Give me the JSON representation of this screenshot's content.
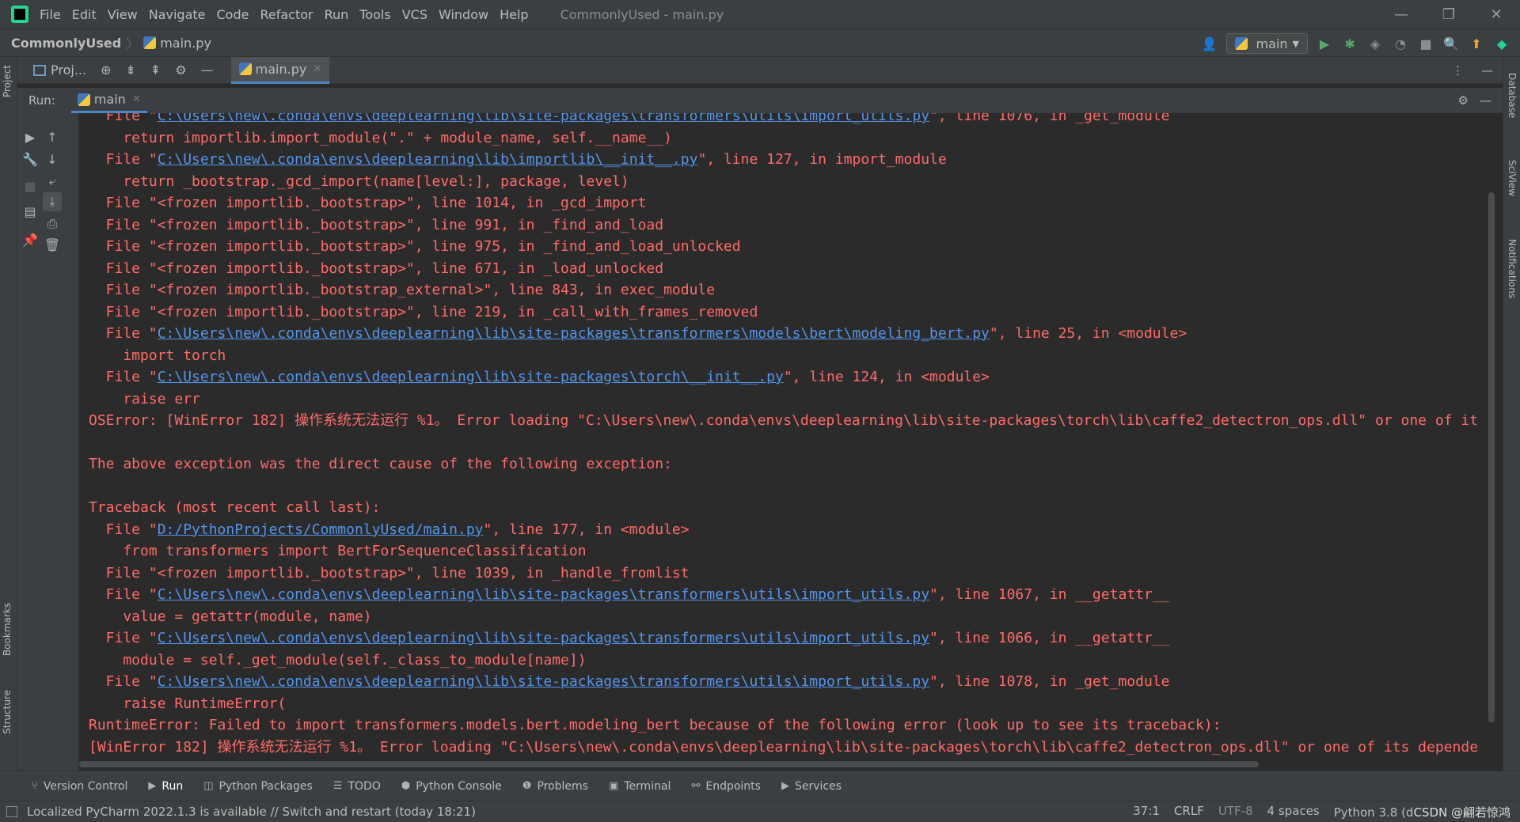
{
  "window": {
    "title": "CommonlyUsed - main.py",
    "menu": [
      "File",
      "Edit",
      "View",
      "Navigate",
      "Code",
      "Refactor",
      "Run",
      "Tools",
      "VCS",
      "Window",
      "Help"
    ],
    "controls": [
      "—",
      "❐",
      "✕"
    ]
  },
  "navbar": {
    "project": "CommonlyUsed",
    "file": "main.py",
    "run_config": "main"
  },
  "tabrow": {
    "project_tab": "Proj...",
    "editor_tab": "main.py"
  },
  "left_stripe": {
    "project": "Project",
    "bookmarks": "Bookmarks",
    "structure": "Structure"
  },
  "right_stripe": {
    "database": "Database",
    "sciview": "SciView",
    "notifications": "Notifications"
  },
  "run_panel": {
    "label": "Run:",
    "tab": "main"
  },
  "console": {
    "lines": [
      {
        "pre": "  File \"",
        "link": "C:\\Users\\new\\.conda\\envs\\deeplearning\\lib\\site-packages\\transformers\\utils\\import_utils.py",
        "post": "\", line 1076, in _get_module"
      },
      {
        "pre": "    return importlib.import_module(\".\" + module_name, self.__name__)",
        "link": "",
        "post": ""
      },
      {
        "pre": "  File \"",
        "link": "C:\\Users\\new\\.conda\\envs\\deeplearning\\lib\\importlib\\__init__.py",
        "post": "\", line 127, in import_module"
      },
      {
        "pre": "    return _bootstrap._gcd_import(name[level:], package, level)",
        "link": "",
        "post": ""
      },
      {
        "pre": "  File \"<frozen importlib._bootstrap>\", line 1014, in _gcd_import",
        "link": "",
        "post": ""
      },
      {
        "pre": "  File \"<frozen importlib._bootstrap>\", line 991, in _find_and_load",
        "link": "",
        "post": ""
      },
      {
        "pre": "  File \"<frozen importlib._bootstrap>\", line 975, in _find_and_load_unlocked",
        "link": "",
        "post": ""
      },
      {
        "pre": "  File \"<frozen importlib._bootstrap>\", line 671, in _load_unlocked",
        "link": "",
        "post": ""
      },
      {
        "pre": "  File \"<frozen importlib._bootstrap_external>\", line 843, in exec_module",
        "link": "",
        "post": ""
      },
      {
        "pre": "  File \"<frozen importlib._bootstrap>\", line 219, in _call_with_frames_removed",
        "link": "",
        "post": ""
      },
      {
        "pre": "  File \"",
        "link": "C:\\Users\\new\\.conda\\envs\\deeplearning\\lib\\site-packages\\transformers\\models\\bert\\modeling_bert.py",
        "post": "\", line 25, in <module>"
      },
      {
        "pre": "    import torch",
        "link": "",
        "post": ""
      },
      {
        "pre": "  File \"",
        "link": "C:\\Users\\new\\.conda\\envs\\deeplearning\\lib\\site-packages\\torch\\__init__.py",
        "post": "\", line 124, in <module>"
      },
      {
        "pre": "    raise err",
        "link": "",
        "post": ""
      },
      {
        "pre": "OSError: [WinError 182] 操作系统无法运行 %1。 Error loading \"C:\\Users\\new\\.conda\\envs\\deeplearning\\lib\\site-packages\\torch\\lib\\caffe2_detectron_ops.dll\" or one of it",
        "link": "",
        "post": ""
      },
      {
        "pre": "",
        "link": "",
        "post": ""
      },
      {
        "pre": "The above exception was the direct cause of the following exception:",
        "link": "",
        "post": ""
      },
      {
        "pre": "",
        "link": "",
        "post": ""
      },
      {
        "pre": "Traceback (most recent call last):",
        "link": "",
        "post": ""
      },
      {
        "pre": "  File \"",
        "link": "D:/PythonProjects/CommonlyUsed/main.py",
        "post": "\", line 177, in <module>"
      },
      {
        "pre": "    from transformers import BertForSequenceClassification",
        "link": "",
        "post": ""
      },
      {
        "pre": "  File \"<frozen importlib._bootstrap>\", line 1039, in _handle_fromlist",
        "link": "",
        "post": ""
      },
      {
        "pre": "  File \"",
        "link": "C:\\Users\\new\\.conda\\envs\\deeplearning\\lib\\site-packages\\transformers\\utils\\import_utils.py",
        "post": "\", line 1067, in __getattr__"
      },
      {
        "pre": "    value = getattr(module, name)",
        "link": "",
        "post": ""
      },
      {
        "pre": "  File \"",
        "link": "C:\\Users\\new\\.conda\\envs\\deeplearning\\lib\\site-packages\\transformers\\utils\\import_utils.py",
        "post": "\", line 1066, in __getattr__"
      },
      {
        "pre": "    module = self._get_module(self._class_to_module[name])",
        "link": "",
        "post": ""
      },
      {
        "pre": "  File \"",
        "link": "C:\\Users\\new\\.conda\\envs\\deeplearning\\lib\\site-packages\\transformers\\utils\\import_utils.py",
        "post": "\", line 1078, in _get_module"
      },
      {
        "pre": "    raise RuntimeError(",
        "link": "",
        "post": ""
      },
      {
        "pre": "RuntimeError: Failed to import transformers.models.bert.modeling_bert because of the following error (look up to see its traceback):",
        "link": "",
        "post": ""
      },
      {
        "pre": "[WinError 182] 操作系统无法运行 %1。 Error loading \"C:\\Users\\new\\.conda\\envs\\deeplearning\\lib\\site-packages\\torch\\lib\\caffe2_detectron_ops.dll\" or one of its depende",
        "link": "",
        "post": ""
      }
    ]
  },
  "bottom_tools": [
    {
      "label": "Version Control",
      "icon": "version-control-icon"
    },
    {
      "label": "Run",
      "icon": "run-icon"
    },
    {
      "label": "Python Packages",
      "icon": "packages-icon"
    },
    {
      "label": "TODO",
      "icon": "todo-icon"
    },
    {
      "label": "Python Console",
      "icon": "python-console-icon"
    },
    {
      "label": "Problems",
      "icon": "problems-icon"
    },
    {
      "label": "Terminal",
      "icon": "terminal-icon"
    },
    {
      "label": "Endpoints",
      "icon": "endpoints-icon"
    },
    {
      "label": "Services",
      "icon": "services-icon"
    }
  ],
  "status": {
    "message": "Localized PyCharm 2022.1.3 is available // Switch and restart (today 18:21)",
    "position": "37:1",
    "line_sep": "CRLF",
    "encoding": "UTF-8",
    "indent": "4 spaces",
    "interpreter": "Python 3.8 (d",
    "watermark": "CSDN @翩若惊鸿"
  },
  "colors": {
    "bg": "#2b2b2b",
    "panel": "#3c3f41",
    "error_text": "#ff6b68",
    "link": "#5394ec",
    "accent": "#4a88c7"
  }
}
